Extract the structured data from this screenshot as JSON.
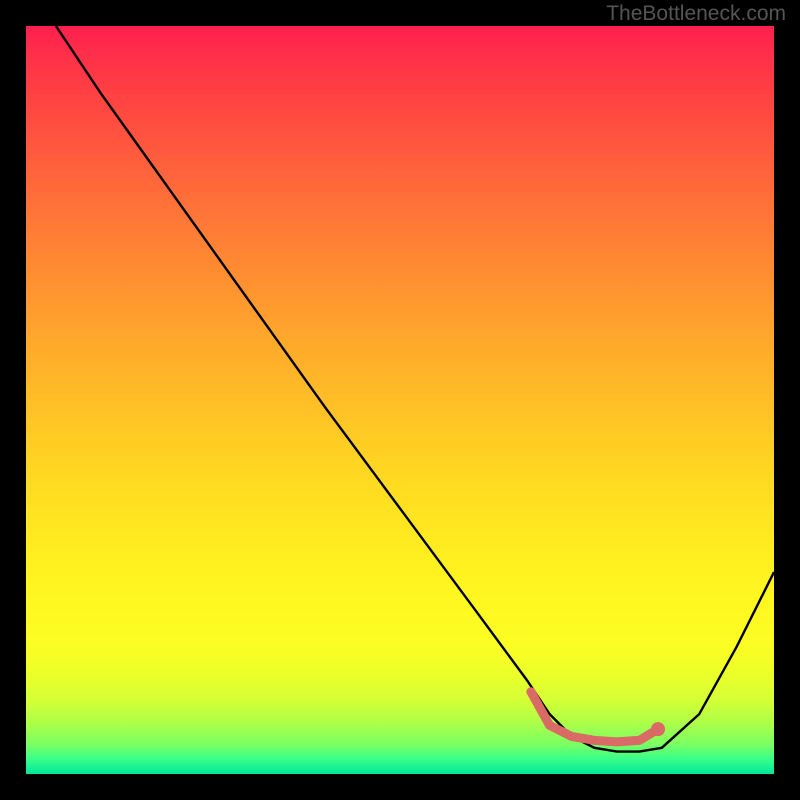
{
  "watermark": "TheBottleneck.com",
  "chart_data": {
    "type": "line",
    "title": "",
    "xlabel": "",
    "ylabel": "",
    "xlim": [
      0,
      100
    ],
    "ylim": [
      0,
      100
    ],
    "series": [
      {
        "name": "main-curve",
        "x": [
          4,
          10,
          20,
          30,
          40,
          50,
          60,
          67,
          70,
          73,
          76,
          79,
          82,
          85,
          90,
          95,
          100
        ],
        "values": [
          100,
          91,
          77,
          63,
          49,
          35.5,
          22,
          12.5,
          8,
          5,
          3.5,
          3,
          3,
          3.5,
          8,
          17,
          27
        ]
      },
      {
        "name": "highlight-segment",
        "x": [
          67.5,
          70,
          73,
          76,
          79,
          82,
          84.5
        ],
        "values": [
          11,
          6.5,
          5,
          4.5,
          4.3,
          4.5,
          6
        ]
      }
    ],
    "highlight_end_marker": {
      "x": 84.5,
      "y": 6
    },
    "gradient_stops": [
      {
        "pct": 0,
        "color": "#ff1f4e"
      },
      {
        "pct": 50,
        "color": "#ffbe26"
      },
      {
        "pct": 82,
        "color": "#fdfd22"
      },
      {
        "pct": 100,
        "color": "#00e69a"
      }
    ]
  }
}
